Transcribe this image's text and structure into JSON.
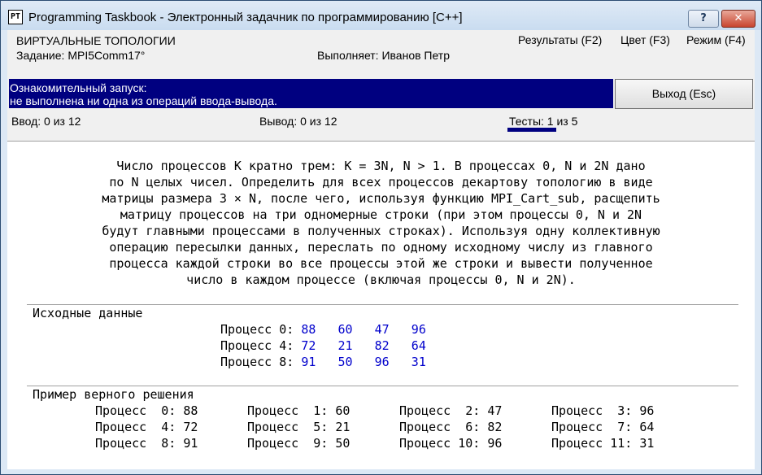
{
  "window": {
    "icon_text": "PT",
    "title": "Programming Taskbook - Электронный задачник по программированию [C++]",
    "help_label": "?",
    "close_label": "✕"
  },
  "header": {
    "topic": "ВИРТУАЛЬНЫЕ ТОПОЛОГИИ",
    "task": "Задание: MPI5Comm17°",
    "performer": "Выполняет: Иванов Петр"
  },
  "menu": {
    "results": "Результаты (F2)",
    "color": "Цвет (F3)",
    "mode": "Режим (F4)"
  },
  "info": {
    "line1": "Ознакомительный запуск:",
    "line2": " не выполнена ни одна из операций ввода-вывода."
  },
  "exit_button": "Выход (Esc)",
  "status": {
    "input": "Ввод: 0 из 12",
    "output": "Вывод: 0 из 12",
    "tests": "Тесты: 1 из 5",
    "tests_progress": 0.2
  },
  "description": [
    "Число процессов K кратно трем: K = 3N, N > 1. В процессах 0, N и 2N дано",
    "по N целых чисел. Определить для всех процессов декартову топологию в виде",
    "матрицы размера 3 × N, после чего, используя функцию MPI_Cart_sub, расщепить",
    "матрицу процессов на три одномерные строки (при этом процессы 0, N и 2N",
    "будут главными процессами в полученных строках). Используя одну коллективную",
    "операцию пересылки данных, переслать по одному исходному числу из главного",
    "процесса каждой строки во все процессы этой же строки и вывести полученное",
    "число в каждом процессе (включая процессы 0, N и 2N)."
  ],
  "input_section": {
    "label": "Исходные данные",
    "rows": [
      {
        "label": "Процесс 0:",
        "values": "88   60   47   96"
      },
      {
        "label": "Процесс 4:",
        "values": "72   21   82   64"
      },
      {
        "label": "Процесс 8:",
        "values": "91   50   96   31"
      }
    ]
  },
  "example_section": {
    "label": "Пример верного решения",
    "rows": [
      [
        "Процесс  0: 88",
        "Процесс  1: 60",
        "Процесс  2: 47",
        "Процесс  3: 96"
      ],
      [
        "Процесс  4: 72",
        "Процесс  5: 21",
        "Процесс  6: 82",
        "Процесс  7: 64"
      ],
      [
        "Процесс  8: 91",
        "Процесс  9: 50",
        "Процесс 10: 96",
        "Процесс 11: 31"
      ]
    ]
  }
}
